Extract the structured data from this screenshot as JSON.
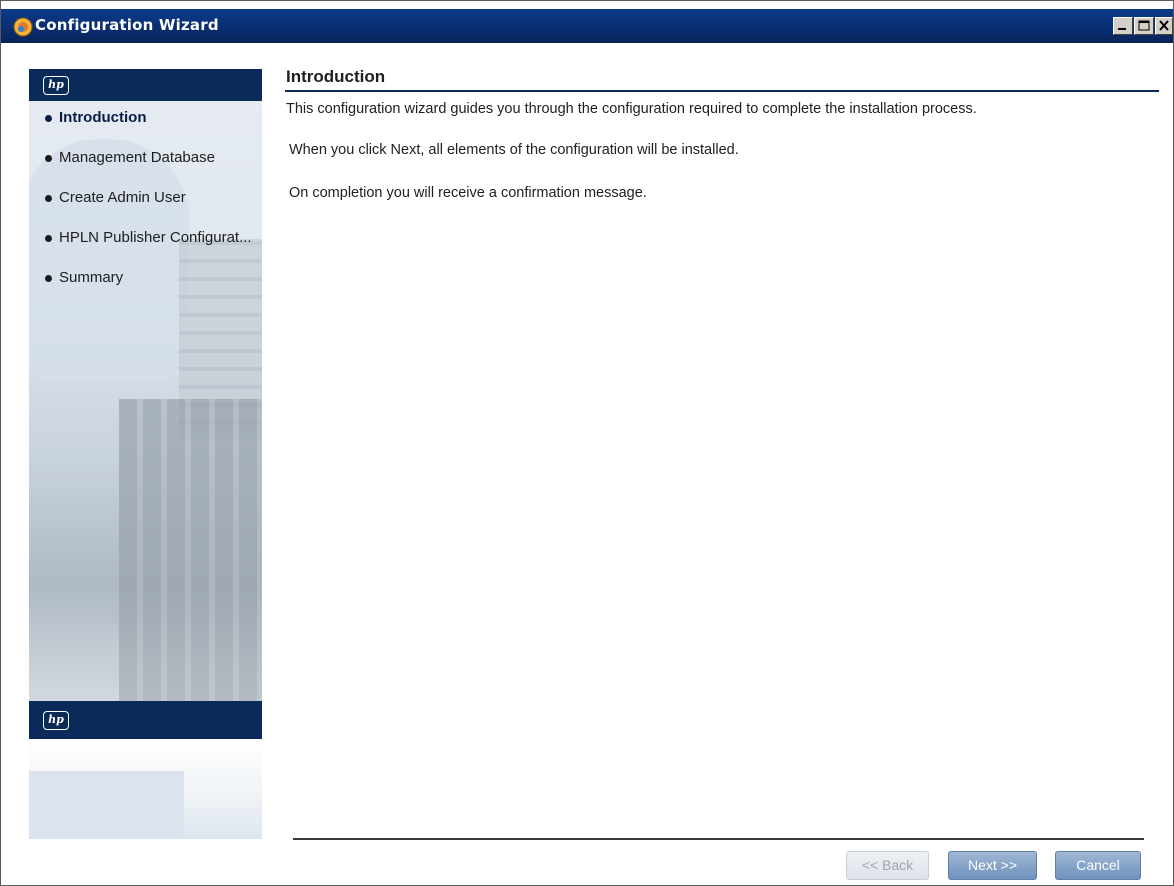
{
  "window": {
    "title": "Configuration Wizard"
  },
  "sidebar": {
    "logo_text": "hp",
    "items": [
      {
        "label": "Introduction",
        "active": true
      },
      {
        "label": "Management Database",
        "active": false
      },
      {
        "label": "Create Admin User",
        "active": false
      },
      {
        "label": "HPLN Publisher Configurat...",
        "active": false
      },
      {
        "label": "Summary",
        "active": false
      }
    ]
  },
  "main": {
    "title": "Introduction",
    "paragraphs": [
      "This configuration wizard guides you through the configuration required to complete the installation process.",
      "When you click Next, all elements of the configuration will be installed.",
      "On completion you will receive a confirmation message."
    ]
  },
  "buttons": {
    "back_label": "<< Back",
    "next_label": "Next >>",
    "cancel_label": "Cancel"
  },
  "colors": {
    "titlebar": "#0a2d6e",
    "brand_navy": "#0a2a5a",
    "button_blue": "#6f92bd"
  }
}
